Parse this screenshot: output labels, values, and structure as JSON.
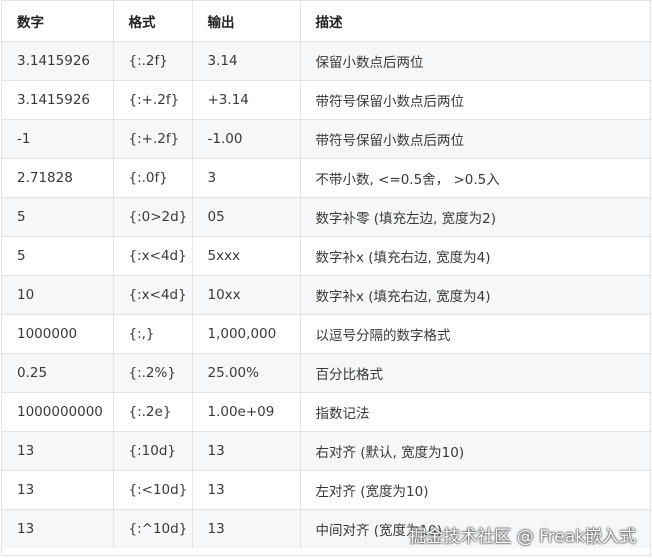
{
  "table": {
    "headers": [
      "数字",
      "格式",
      "输出",
      "描述"
    ],
    "rows": [
      [
        "3.1415926",
        "{:.2f}",
        "3.14",
        "保留小数点后两位"
      ],
      [
        "3.1415926",
        "{:+.2f}",
        "+3.14",
        "带符号保留小数点后两位"
      ],
      [
        "-1",
        "{:+.2f}",
        "-1.00",
        "带符号保留小数点后两位"
      ],
      [
        "2.71828",
        "{:.0f}",
        "3",
        "不带小数, <=0.5舍， >0.5入"
      ],
      [
        "5",
        "{:0>2d}",
        "05",
        "数字补零 (填充左边, 宽度为2)"
      ],
      [
        "5",
        "{:x<4d}",
        "5xxx",
        "数字补x (填充右边, 宽度为4)"
      ],
      [
        "10",
        "{:x<4d}",
        "10xx",
        "数字补x (填充右边, 宽度为4)"
      ],
      [
        "1000000",
        "{:,}",
        "1,000,000",
        "以逗号分隔的数字格式"
      ],
      [
        "0.25",
        "{:.2%}",
        "25.00%",
        "百分比格式"
      ],
      [
        "1000000000",
        "{:.2e}",
        "1.00e+09",
        "指数记法"
      ],
      [
        "13",
        "{:10d}",
        "13",
        "右对齐 (默认, 宽度为10)"
      ],
      [
        "13",
        "{:<10d}",
        "13",
        "左对齐 (宽度为10)"
      ],
      [
        "13",
        "{:^10d}",
        "13",
        "中间对齐 (宽度为10)"
      ]
    ]
  },
  "watermark": "掘金技术社区 @ Freak嵌入式",
  "colors": {
    "border": "#e3e3e3",
    "stripe": "#f6f7f8",
    "text": "#3a3a3a"
  }
}
